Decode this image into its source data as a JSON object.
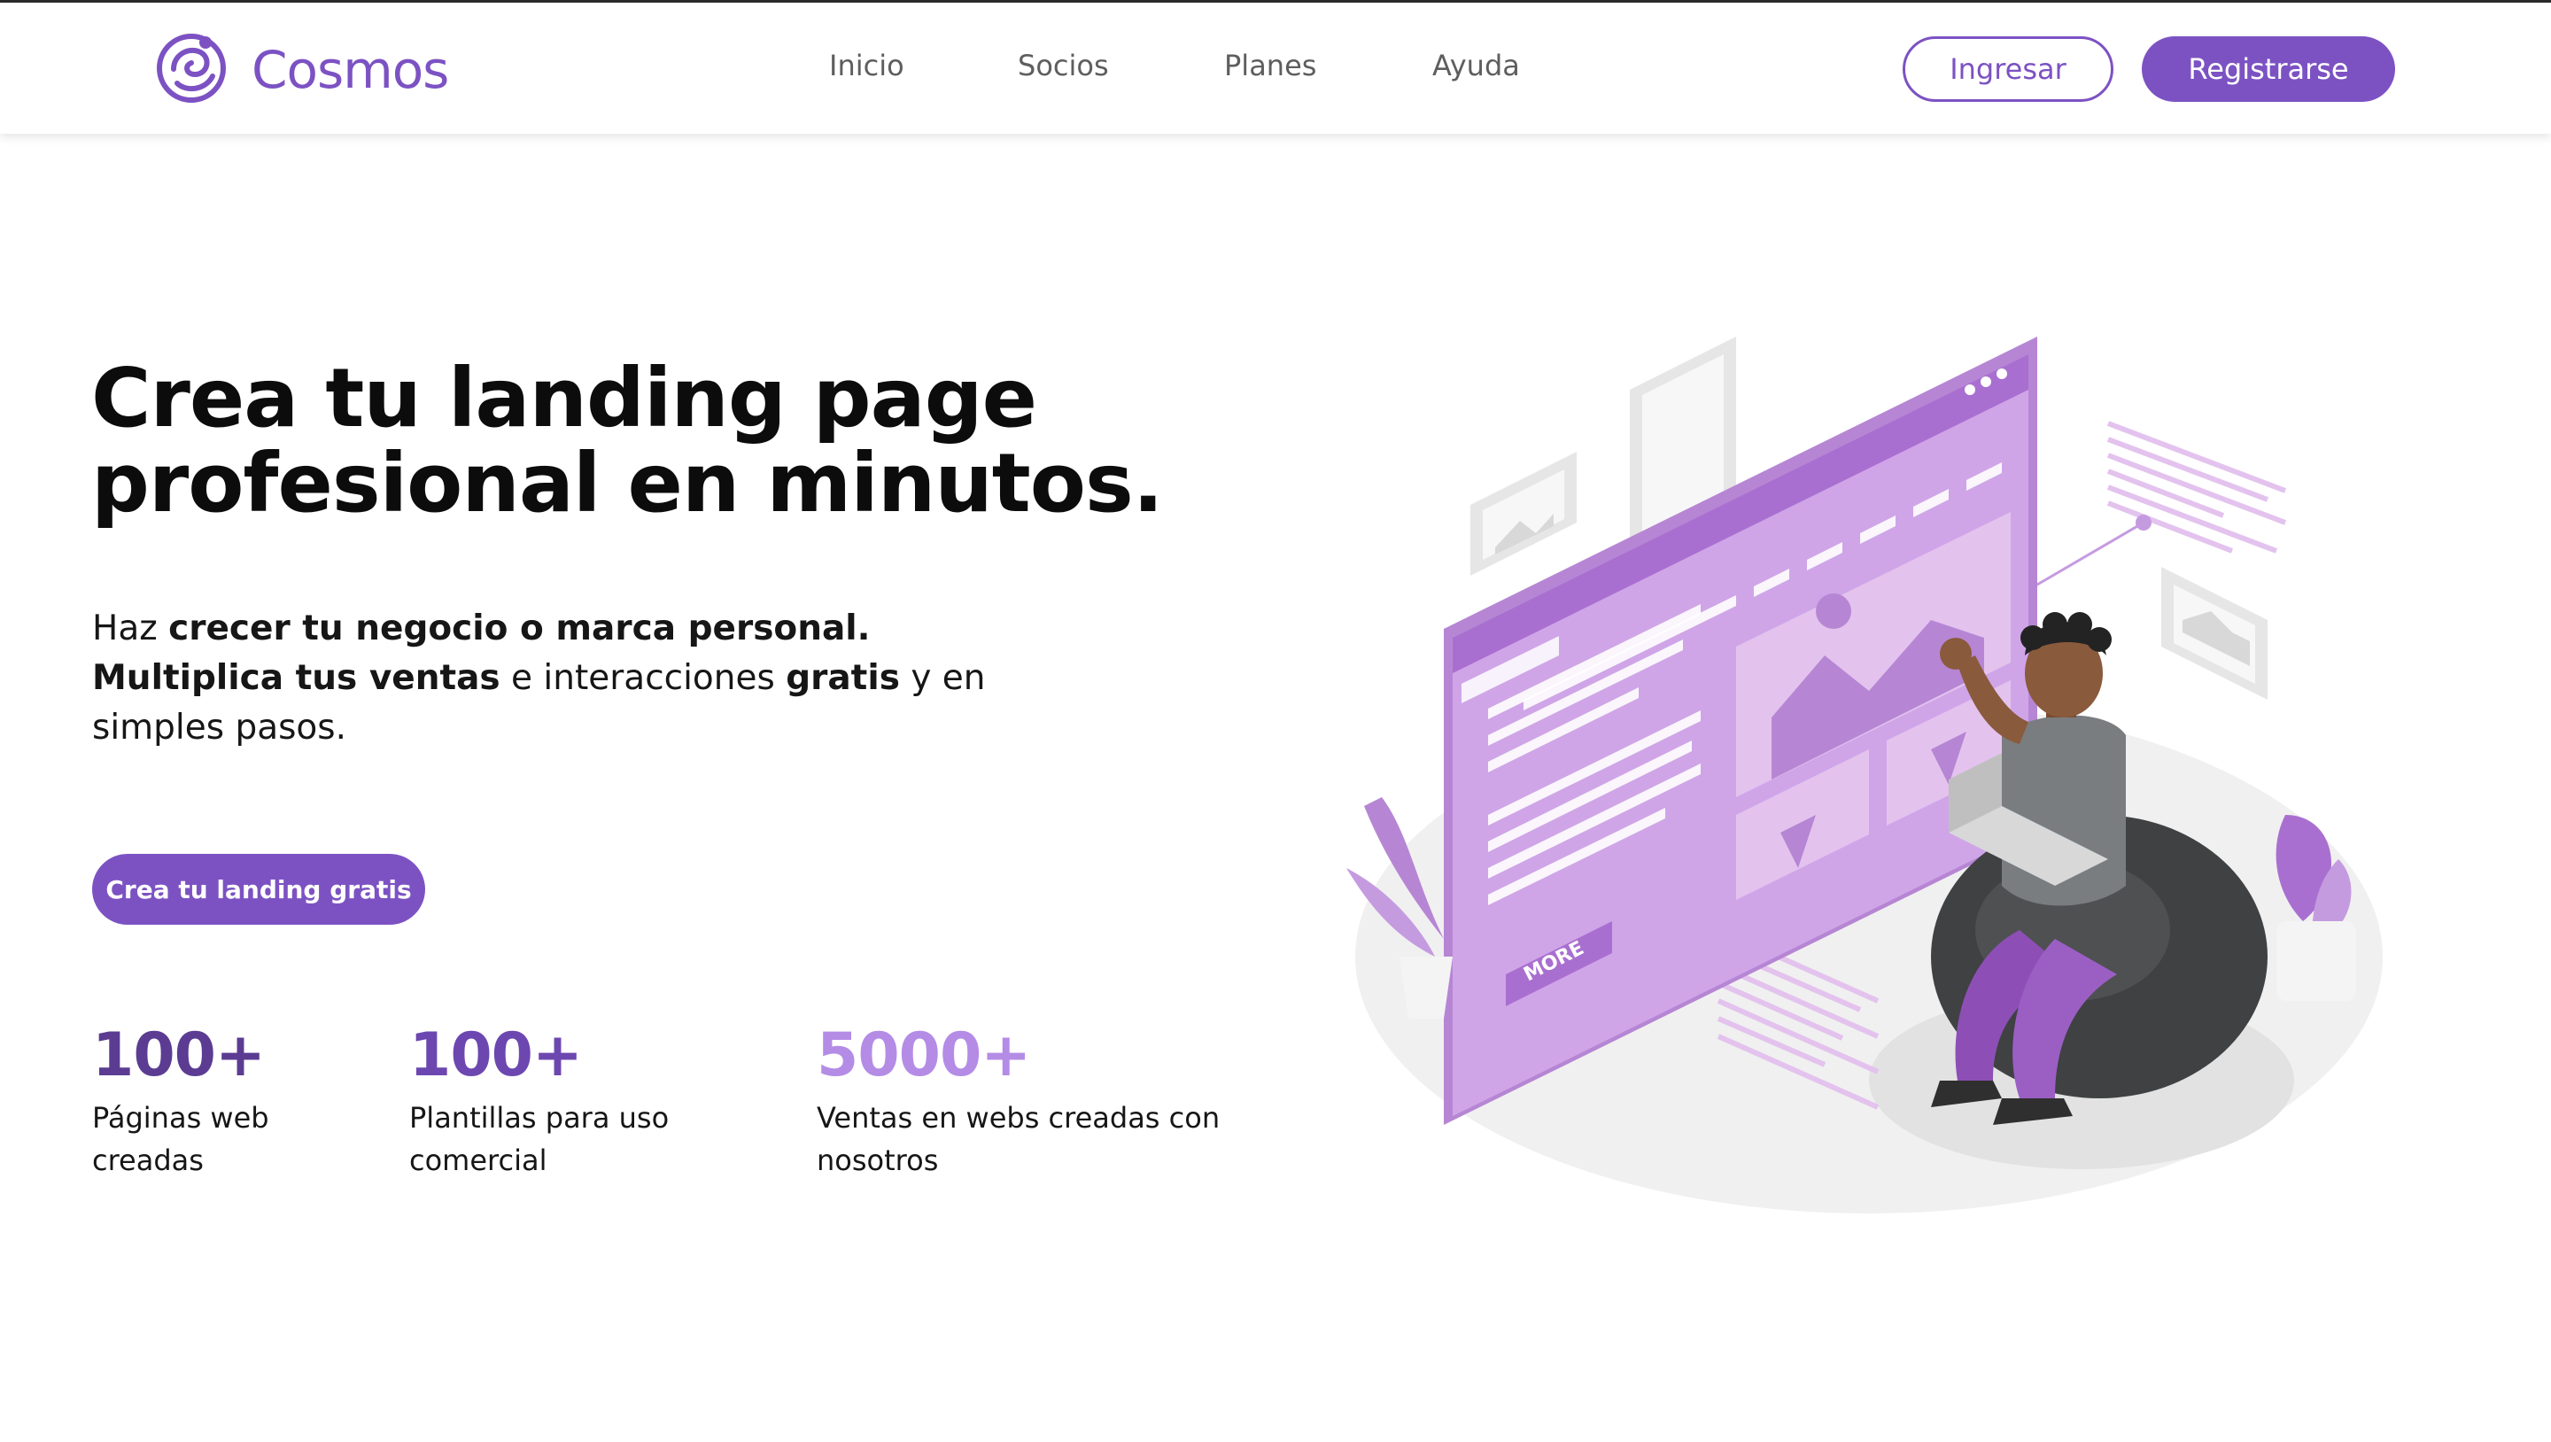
{
  "brand": {
    "name": "Cosmos"
  },
  "nav": {
    "items": [
      "Inicio",
      "Socios",
      "Planes",
      "Ayuda"
    ]
  },
  "auth": {
    "login_label": "Ingresar",
    "register_label": "Registrarse"
  },
  "hero": {
    "title_line1": "Crea tu landing page",
    "title_line2": "profesional en minutos.",
    "subtitle_parts": [
      {
        "text": "Haz ",
        "bold": false
      },
      {
        "text": "crecer tu negocio o marca personal. Multiplica tus ventas",
        "bold": true
      },
      {
        "text": " e interacciones ",
        "bold": false
      },
      {
        "text": "gratis",
        "bold": true
      },
      {
        "text": " y en simples pasos.",
        "bold": false
      }
    ],
    "cta_label": "Crea tu landing gratis",
    "illustration_button_label": "MORE"
  },
  "stats": [
    {
      "value": "100+",
      "label_line1": "Páginas web",
      "label_line2": "creadas",
      "color": "#5b3c92"
    },
    {
      "value": "100+",
      "label_line1": "Plantillas para uso",
      "label_line2": "comercial",
      "color": "#6d47b0"
    },
    {
      "value": "5000+",
      "label_line1": "Ventas en webs creadas con",
      "label_line2": "nosotros",
      "color": "#b48ce6"
    }
  ],
  "colors": {
    "brand": "#7c52c3",
    "illustration_primary": "#c59be0",
    "illustration_dark": "#9b62c7"
  },
  "icons": [
    "cosmos-logo-icon"
  ]
}
